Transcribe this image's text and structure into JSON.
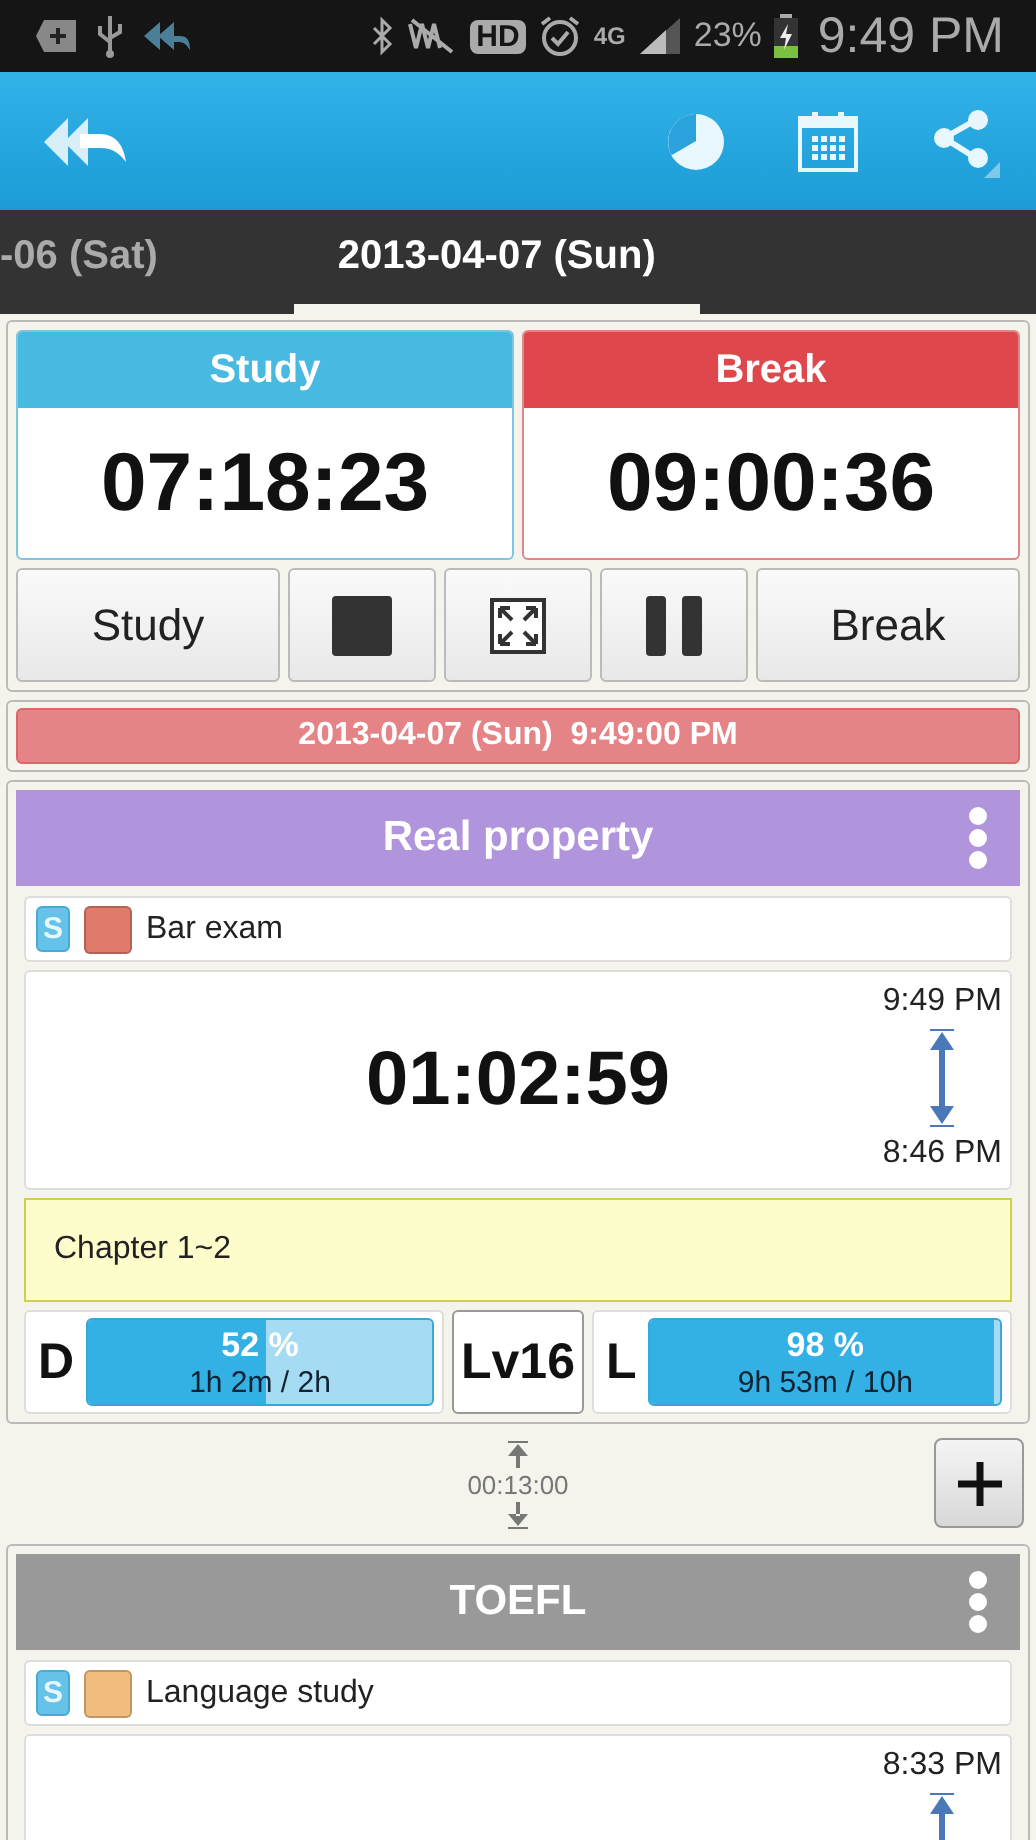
{
  "status_bar": {
    "hd": "HD",
    "network": "4G",
    "battery": "23%",
    "time": "9:49 PM"
  },
  "date_tabs": [
    {
      "label": "-06 (Sat)",
      "selected": false
    },
    {
      "label": "2013-04-07 (Sun)",
      "selected": true
    }
  ],
  "timers": [
    {
      "kind": "study",
      "label": "Study",
      "value": "07:18:23"
    },
    {
      "kind": "break",
      "label": "Break",
      "value": "09:00:36"
    }
  ],
  "controls": [
    {
      "kind": "text",
      "label": "Study"
    },
    {
      "kind": "stop"
    },
    {
      "kind": "fullscreen"
    },
    {
      "kind": "pause"
    },
    {
      "kind": "text",
      "label": "Break"
    }
  ],
  "current_time": "2013-04-07 (Sun)  9:49:00 PM",
  "sessions": [
    {
      "title": "Real property",
      "color": "#b094dc",
      "tag": "S",
      "category": {
        "label": "Bar exam",
        "color": "#e07a6a"
      },
      "duration": "01:02:59",
      "end_time": "9:49 PM",
      "start_time": "8:46 PM",
      "note": "Chapter 1~2",
      "daily": {
        "letter": "D",
        "percent": "52 %",
        "detail": "1h 2m / 2h",
        "level": 0.52
      },
      "level_badge": "Lv16",
      "life": {
        "letter": "L",
        "percent": "98 %",
        "detail": "9h 53m / 10h",
        "level": 0.98
      },
      "gap": "00:13:00"
    },
    {
      "title": "TOEFL",
      "color": "#999999",
      "tag": "S",
      "category": {
        "label": "Language study",
        "color": "#f1bd7e"
      },
      "end_time": "8:33 PM"
    }
  ]
}
